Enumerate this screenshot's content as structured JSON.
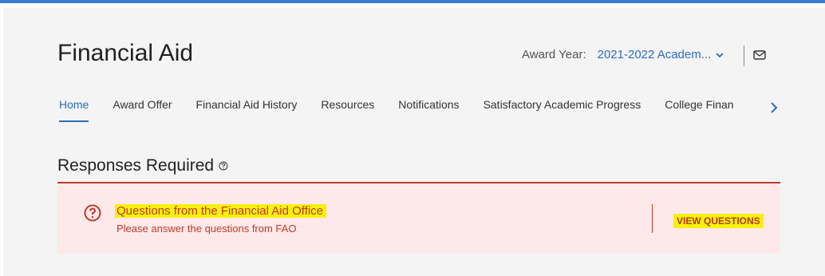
{
  "header": {
    "title": "Financial Aid",
    "award_year_label": "Award Year:",
    "award_year_value": "2021-2022 Academ..."
  },
  "nav": {
    "tabs": [
      "Home",
      "Award Offer",
      "Financial Aid History",
      "Resources",
      "Notifications",
      "Satisfactory Academic Progress",
      "College Finan"
    ],
    "active": "Home"
  },
  "section": {
    "title": "Responses Required"
  },
  "alert": {
    "heading": "Questions from the Financial Aid Office",
    "message": "Please answer the questions from FAO",
    "action": "VIEW QUESTIONS"
  },
  "colors": {
    "accent": "#2c6bbf",
    "alert_red": "#c0392b",
    "highlight": "#f8f00e"
  },
  "icons": [
    "mail-icon",
    "chevron-down-icon",
    "chevron-right-icon",
    "help-circle-icon",
    "question-circle-icon"
  ]
}
